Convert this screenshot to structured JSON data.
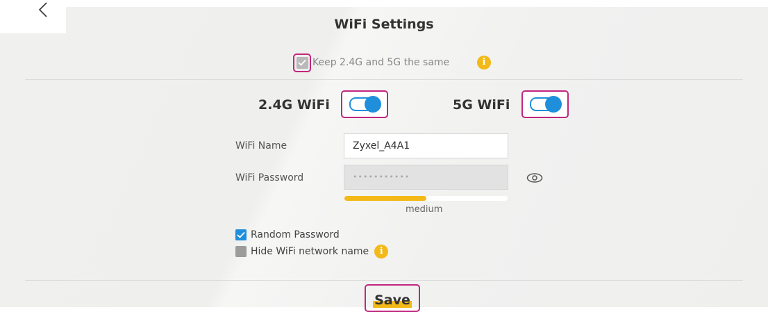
{
  "header": {
    "title": "WiFi Settings",
    "back_icon": "chevron-left-icon"
  },
  "sync": {
    "label": "Keep 2.4G and 5G the same",
    "checked": true
  },
  "bands": {
    "band24": {
      "label": "2.4G WiFi",
      "enabled": true
    },
    "band5": {
      "label": "5G WiFi",
      "enabled": true
    }
  },
  "form": {
    "name_label": "WiFi Name",
    "name_value": "Zyxel_A4A1",
    "password_label": "WiFi Password",
    "password_value": "•••••••••••",
    "strength_label": "medium",
    "strength_fraction": 0.5
  },
  "options": {
    "random_password": {
      "label": "Random Password",
      "checked": true
    },
    "hide_ssid": {
      "label": "Hide WiFi network name",
      "checked": false
    }
  },
  "actions": {
    "save_label": "Save"
  },
  "colors": {
    "accent_blue": "#1f8fdc",
    "highlight": "#c0267e",
    "info_yellow": "#f3b918"
  }
}
